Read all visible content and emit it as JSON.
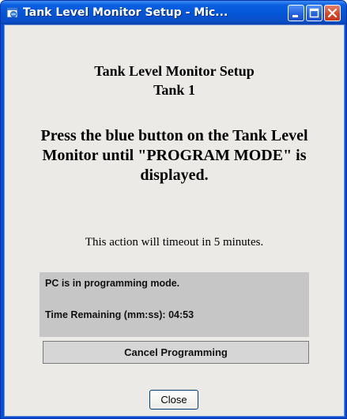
{
  "window": {
    "title": "Tank Level Monitor Setup - Mic..."
  },
  "content": {
    "heading_line1": "Tank Level Monitor Setup",
    "heading_line2": "Tank 1",
    "instruction": "Press the blue button on the Tank Level Monitor until \"PROGRAM MODE\" is displayed.",
    "timeout_notice": "This action will timeout in 5 minutes."
  },
  "status": {
    "mode_text": "PC is in programming mode.",
    "time_label": "Time Remaining (mm:ss): ",
    "time_value": "04:53"
  },
  "buttons": {
    "cancel_label": "Cancel Programming",
    "close_label": "Close"
  },
  "colors": {
    "titlebar": "#0355d8",
    "client_bg": "#ebeae6",
    "status_box_bg": "#c6c6c6"
  },
  "icons": {
    "title_icon": "ie-window-icon",
    "minimize": "minimize-icon",
    "maximize": "maximize-icon",
    "close": "close-icon"
  }
}
